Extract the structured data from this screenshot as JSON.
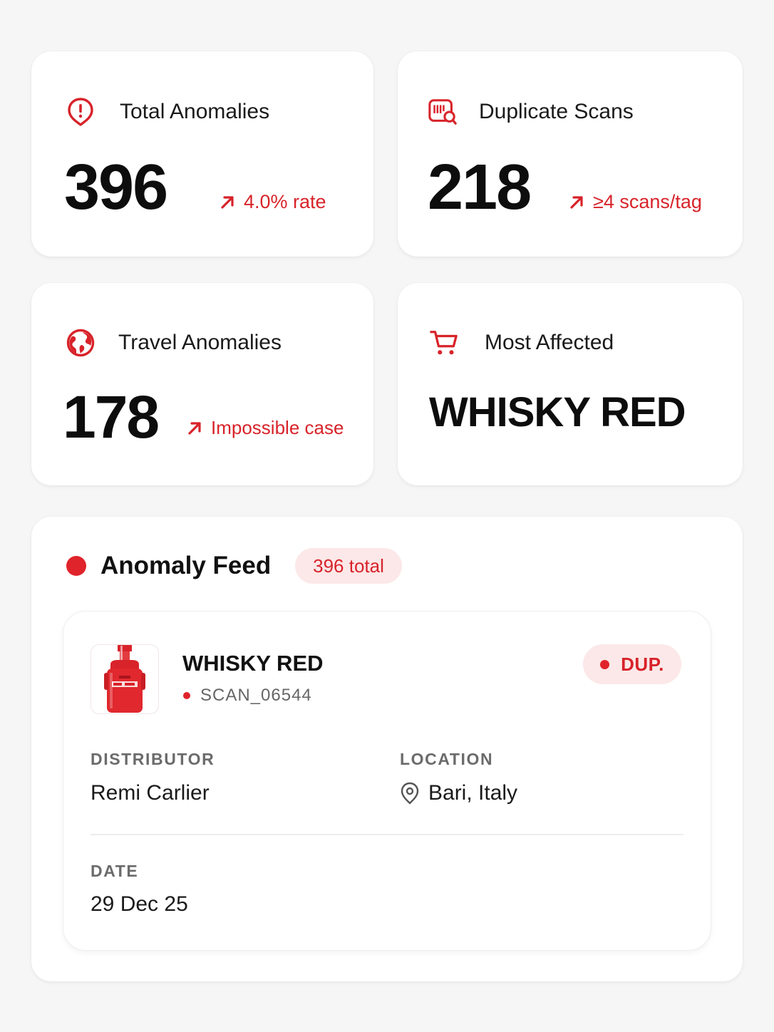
{
  "stats": {
    "total": {
      "title": "Total Anomalies",
      "value": "396",
      "trend": "4.0% rate",
      "icon": "alert-pin-icon"
    },
    "duplicate": {
      "title": "Duplicate Scans",
      "value": "218",
      "trend": "≥4 scans/tag",
      "icon": "barcode-search-icon"
    },
    "travel": {
      "title": "Travel Anomalies",
      "value": "178",
      "trend": "Impossible case",
      "icon": "globe-icon"
    },
    "affected": {
      "title": "Most Affected",
      "value": "WHISKY RED",
      "icon": "cart-icon"
    }
  },
  "feed": {
    "title": "Anomaly Feed",
    "count_badge": "396 total",
    "item": {
      "product": "WHISKY RED",
      "scan_id": "SCAN_06544",
      "status": "DUP.",
      "distributor_label": "DISTRIBUTOR",
      "distributor": "Remi Carlier",
      "location_label": "LOCATION",
      "location": "Bari, Italy",
      "date_label": "DATE",
      "date": "29 Dec 25"
    }
  },
  "colors": {
    "accent": "#d8232a",
    "accent_soft": "#fce8e8",
    "background": "#f6f6f7",
    "card": "#ffffff"
  }
}
